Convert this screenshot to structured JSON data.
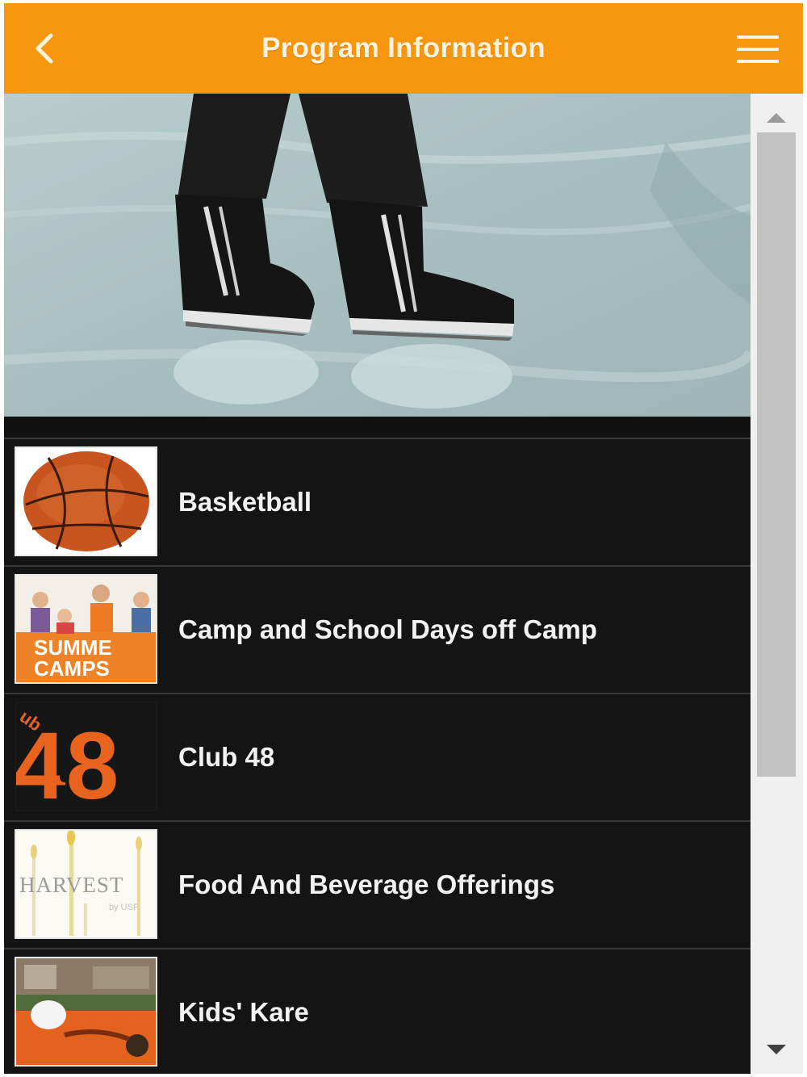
{
  "header": {
    "title": "Program Information",
    "back_icon": "chevron-left-icon",
    "menu_icon": "hamburger-menu-icon"
  },
  "hero": {
    "icon": "ice-skates-photo"
  },
  "programs": [
    {
      "label": "Basketball",
      "thumbnail": "basketball-image"
    },
    {
      "label": "Camp and School Days off Camp",
      "thumbnail": "summer-camps-image",
      "thumb_text": [
        "SUMME",
        "CAMPS"
      ]
    },
    {
      "label": "Club 48",
      "thumbnail": "club-48-logo",
      "thumb_text": [
        "48",
        "ub"
      ]
    },
    {
      "label": "Food And Beverage Offerings",
      "thumbnail": "harvest-logo",
      "thumb_text": [
        "HARVEST",
        "by USF"
      ]
    },
    {
      "label": "Kids' Kare",
      "thumbnail": "kids-kare-image"
    }
  ],
  "colors": {
    "accent": "#f7960f",
    "list_background": "#141414",
    "text": "#f2f2f2"
  }
}
